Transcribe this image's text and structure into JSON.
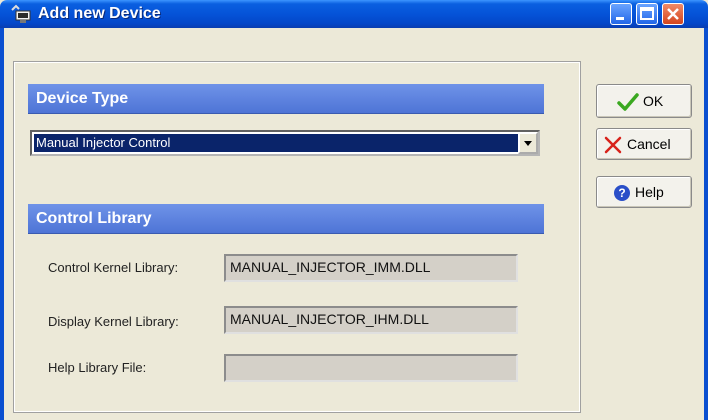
{
  "window": {
    "title": "Add new Device"
  },
  "device_type": {
    "header": "Device Type",
    "selected": "Manual Injector Control"
  },
  "control_library": {
    "header": "Control Library",
    "fields": [
      {
        "label": "Control Kernel Library:",
        "value": "MANUAL_INJECTOR_IMM.DLL"
      },
      {
        "label": "Display Kernel Library:",
        "value": "MANUAL_INJECTOR_IHM.DLL"
      },
      {
        "label": "Help Library File:",
        "value": ""
      }
    ]
  },
  "buttons": {
    "ok": "OK",
    "cancel": "Cancel",
    "help": "Help"
  },
  "colors": {
    "title_bar": "#0553D8",
    "section_header": "#5A7FDE",
    "ok_check": "#3AA820",
    "cancel_x": "#D8221A",
    "help_icon": "#2A4FC8"
  },
  "icons": {
    "app": "device-monitor-icon",
    "ok": "checkmark-icon",
    "cancel": "x-mark-icon",
    "help": "question-circle-icon"
  }
}
